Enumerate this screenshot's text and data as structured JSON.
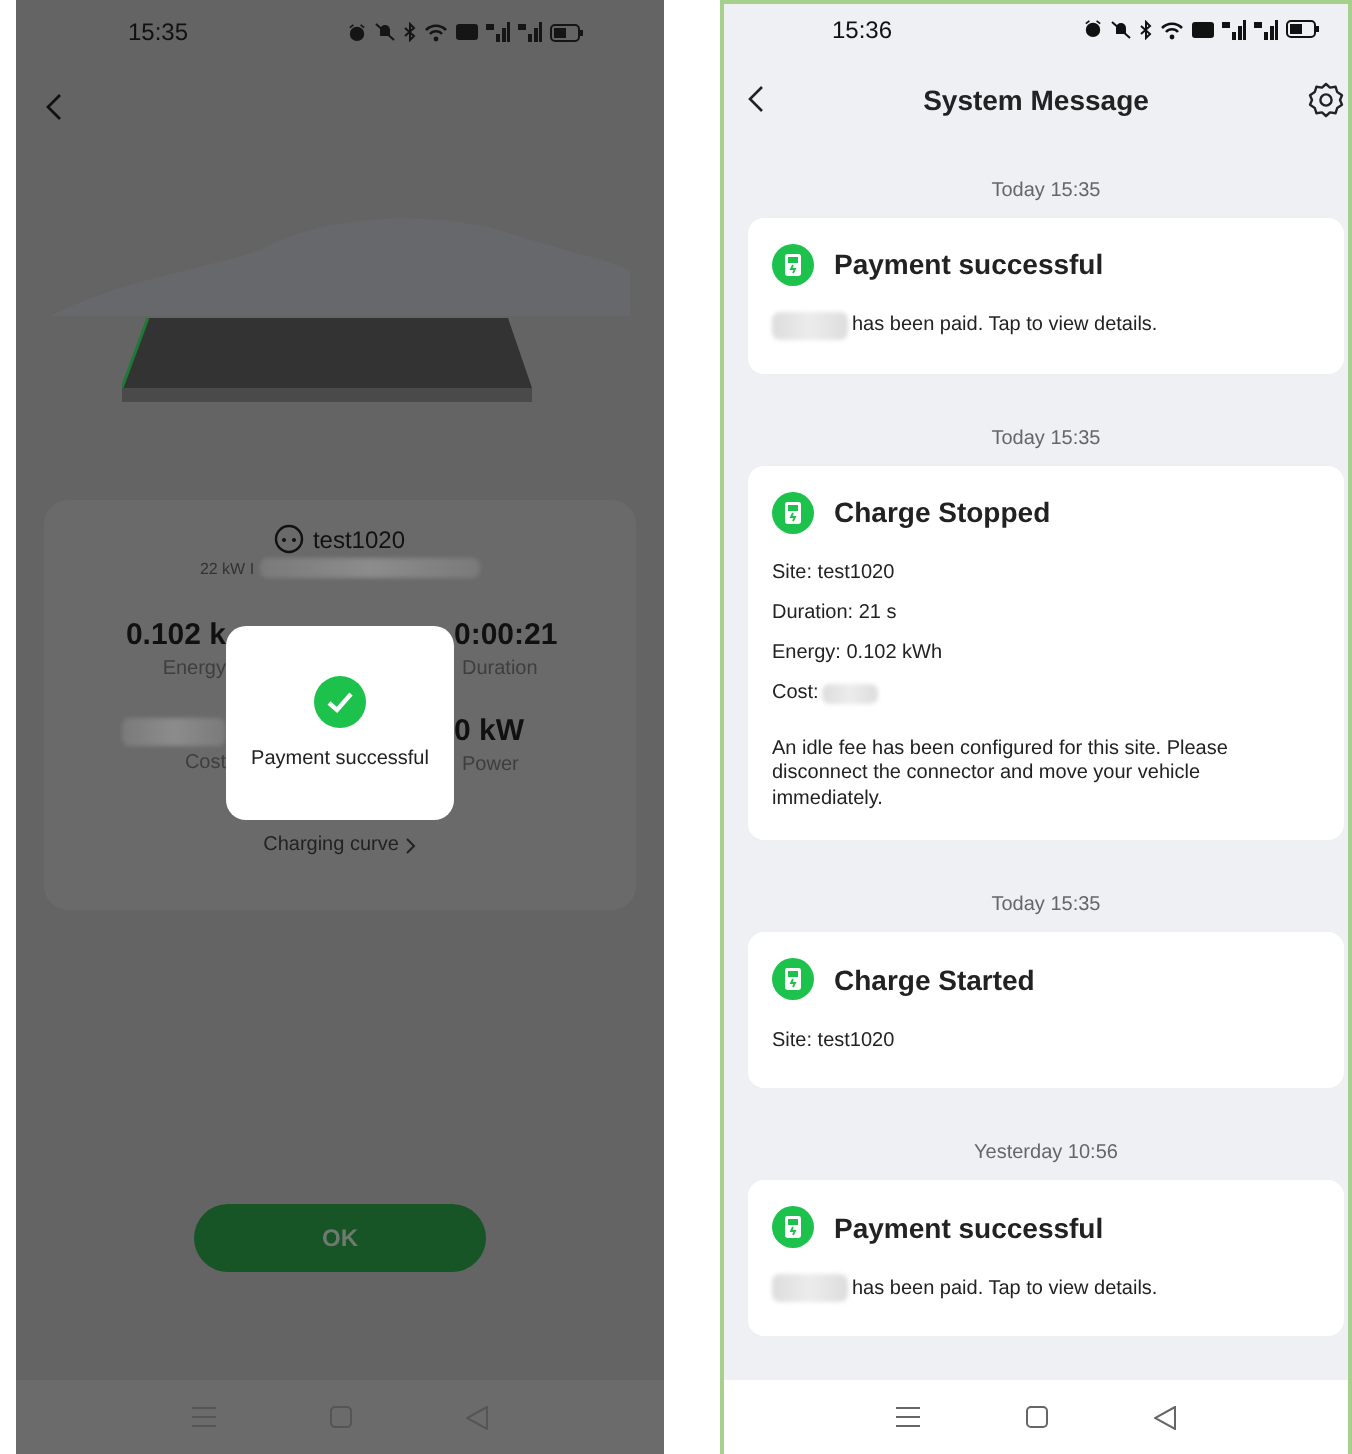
{
  "left_screen": {
    "status_bar": {
      "time": "15:35"
    },
    "charger": {
      "name": "test1020",
      "spec": "22 kW I"
    },
    "stats": [
      {
        "value": "0.102 k",
        "label": "Energy",
        "value_redacted": false
      },
      {
        "value": "0:00:21",
        "label": "Duration",
        "value_redacted": false
      },
      {
        "label": "Cost",
        "value_redacted": true
      },
      {
        "value": "0 kW",
        "label": "Power",
        "value_redacted": false
      }
    ],
    "link": "Charging curve",
    "toast": {
      "message": "Payment successful"
    },
    "ok_button": "OK"
  },
  "right_screen": {
    "status_bar": {
      "time": "15:36"
    },
    "title": "System Message",
    "messages": [
      {
        "timestamp": "Today 15:35",
        "title": "Payment successful",
        "lines": [
          {
            "kind": "redacted_prefix",
            "text": "has been paid. Tap to view details."
          }
        ]
      },
      {
        "timestamp": "Today 15:35",
        "title": "Charge Stopped",
        "lines": [
          {
            "kind": "text",
            "text": "Site: test1020"
          },
          {
            "kind": "text",
            "text": "Duration:  21 s"
          },
          {
            "kind": "text",
            "text": "Energy: 0.102 kWh"
          },
          {
            "kind": "redacted_suffix",
            "text": "Cost:"
          },
          {
            "kind": "note",
            "text": "An idle fee has been configured for this site. Please disconnect the connector and move your vehicle immediately."
          }
        ]
      },
      {
        "timestamp": "Today 15:35",
        "title": "Charge Started",
        "lines": [
          {
            "kind": "text",
            "text": "Site: test1020"
          }
        ]
      },
      {
        "timestamp": "Yesterday 10:56",
        "title": "Payment successful",
        "lines": [
          {
            "kind": "redacted_prefix",
            "text": "has been paid. Tap to view details."
          }
        ]
      }
    ]
  }
}
